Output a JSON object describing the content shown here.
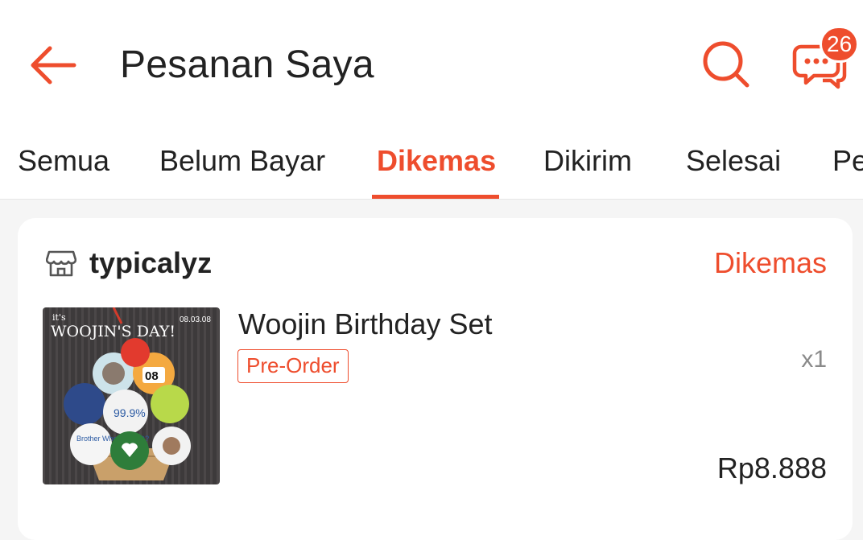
{
  "header": {
    "title": "Pesanan Saya",
    "back_icon": "arrow-left-icon",
    "search_icon": "search-icon",
    "chat_icon": "chat-bubbles-icon",
    "chat_badge_count": "26",
    "accent_color": "#ee4d2d"
  },
  "tabs": [
    {
      "label": "Semua",
      "active": false
    },
    {
      "label": "Belum Bayar",
      "active": false
    },
    {
      "label": "Dikemas",
      "active": true
    },
    {
      "label": "Dikirim",
      "active": false
    },
    {
      "label": "Selesai",
      "active": false
    },
    {
      "label": "Pe",
      "active": false
    }
  ],
  "order": {
    "shop_icon": "shop-icon",
    "shop_name": "typicalyz",
    "status": "Dikemas",
    "product": {
      "name": "Woojin Birthday Set",
      "tag": "Pre-Order",
      "quantity": "x1",
      "price": "Rp8.888",
      "image": {
        "title_small": "it's",
        "title": "WOOJIN'S DAY!",
        "date": "08.03.08",
        "badges": [
          "08",
          "99.9%",
          "Brother Where You@?"
        ]
      }
    }
  }
}
